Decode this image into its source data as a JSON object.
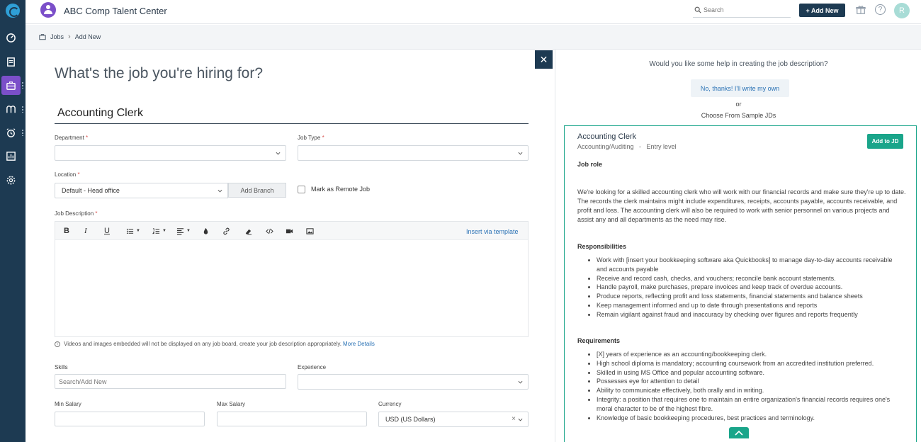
{
  "topbar": {
    "brand": "ABC Comp Talent Center",
    "search_placeholder": "Search",
    "add_new_label": "+ Add New",
    "help_glyph": "?",
    "avatar_initial": "R"
  },
  "breadcrumb": {
    "items": [
      "Jobs",
      "Add New"
    ]
  },
  "sidebar": {
    "icons": [
      "dashboard-icon",
      "notes-icon",
      "briefcase-icon",
      "candidates-icon",
      "alarm-icon",
      "reports-icon",
      "settings-icon"
    ],
    "active": "briefcase-icon"
  },
  "form": {
    "heading": "What's the job you're hiring for?",
    "job_title": "Accounting Clerk",
    "department_label": "Department",
    "job_type_label": "Job Type",
    "location_label": "Location",
    "location_value": "Default - Head office",
    "add_branch_label": "Add Branch",
    "remote_label": "Mark as Remote Job",
    "job_description_label": "Job Description",
    "required_mark": "*",
    "insert_template_label": "Insert via template",
    "embed_note": "Videos and images embedded will not be displayed on any job board, create your job description appropriately.",
    "more_details_label": "More Details",
    "skills_label": "Skills",
    "skills_placeholder": "Search/Add New",
    "experience_label": "Experience",
    "min_salary_label": "Min Salary",
    "max_salary_label": "Max Salary",
    "currency_label": "Currency",
    "currency_value": "USD (US Dollars)",
    "toolbar_labels": {
      "bold": "B",
      "italic": "I",
      "underline": "U"
    }
  },
  "panel": {
    "help_question": "Would you like some help in creating the job description?",
    "no_thanks_label": "No, thanks! I'll write my own",
    "or_label": "or",
    "choose_label": "Choose From Sample JDs",
    "close_glyph": "✕",
    "card": {
      "title": "Accounting Clerk",
      "subtitle": "Accounting/Auditing   -   Entry level",
      "add_label": "Add to JD",
      "job_role_heading": "Job role",
      "job_role_text": "We're looking for a skilled accounting clerk who will work with our financial records and make sure they're up to date. The records the clerk maintains might include expenditures, receipts, accounts payable, accounts receivable, and profit and loss. The accounting clerk will also be required to work with senior personnel on various projects and assist any and all departments as the need may rise.",
      "responsibilities_heading": "Responsibilities",
      "responsibilities": [
        "Work with [insert your bookkeeping software aka Quickbooks] to manage day-to-day accounts receivable and accounts payable",
        "Receive and record cash, checks, and vouchers; reconcile bank account statements.",
        "Handle payroll, make purchases, prepare invoices and keep track of overdue accounts.",
        "Produce reports, reflecting profit and loss statements, financial statements and balance sheets",
        "Keep management informed and up to date through presentations and reports",
        "Remain vigilant against fraud and inaccuracy by checking over figures and reports frequently"
      ],
      "requirements_heading": "Requirements",
      "requirements": [
        "[X] years of experience as an accounting/bookkeeping clerk.",
        "High school diploma is mandatory; accounting coursework from an accredited institution preferred.",
        "Skilled in using MS Office and popular accounting software.",
        "Possesses eye for attention to detail",
        "Ability to communicate effectively, both orally and in writing.",
        "Integrity: a position that requires one to maintain an entire organization's financial records requires one's moral character to be of the highest fibre.",
        "Knowledge of basic bookkeeping procedures, best practices and terminology."
      ]
    }
  },
  "colors": {
    "sidebar": "#1d3a52",
    "accent_purple": "#7b4fc9",
    "accent_green": "#1aa58a",
    "link_blue": "#2a72b5"
  }
}
